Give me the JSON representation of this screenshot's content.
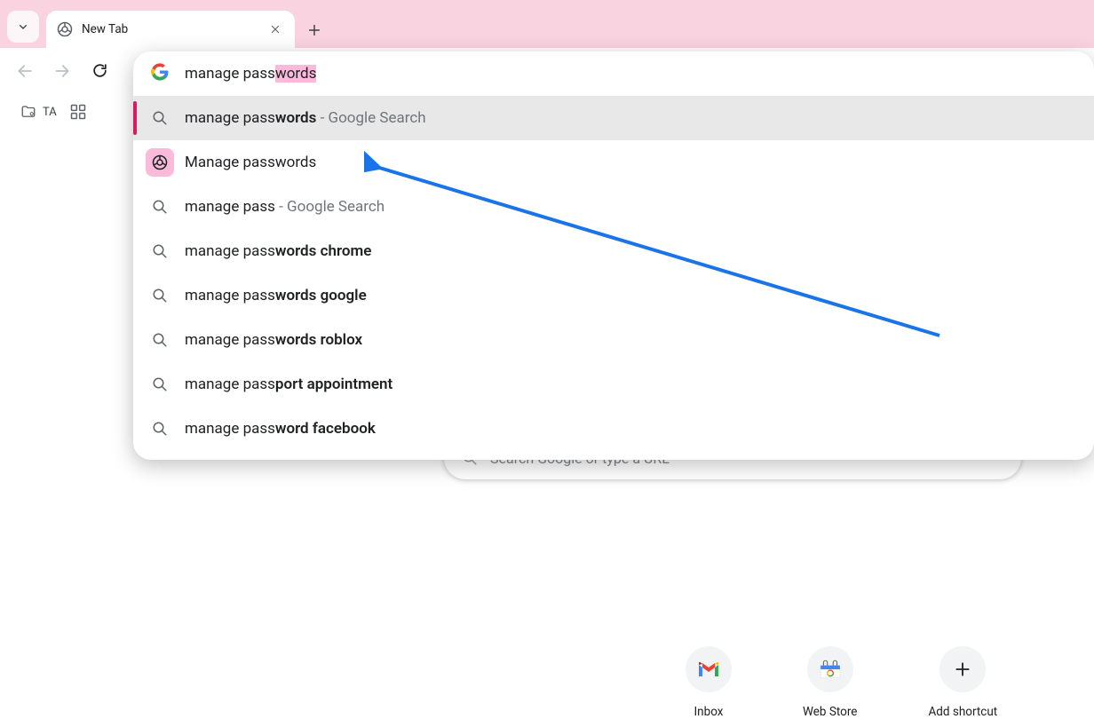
{
  "tab": {
    "title": "New Tab"
  },
  "bookmarks": {
    "ta_label": "TA"
  },
  "omnibox": {
    "query_plain": "manage pass",
    "query_highlight": "words",
    "suggestions": [
      {
        "kind": "search-selected",
        "prefix": "manage pass",
        "bold": "words",
        "suffix": " - Google Search"
      },
      {
        "kind": "chrome-setting",
        "label": "Manage passwords"
      },
      {
        "kind": "search",
        "prefix": "manage pass",
        "bold": "",
        "suffix": " - Google Search"
      },
      {
        "kind": "search",
        "prefix": "manage pass",
        "bold": "words chrome",
        "suffix": ""
      },
      {
        "kind": "search",
        "prefix": "manage pass",
        "bold": "words google",
        "suffix": ""
      },
      {
        "kind": "search",
        "prefix": "manage pass",
        "bold": "words roblox",
        "suffix": ""
      },
      {
        "kind": "search",
        "prefix": "manage pass",
        "bold": "port appointment",
        "suffix": ""
      },
      {
        "kind": "search",
        "prefix": "manage pass",
        "bold": "word facebook",
        "suffix": ""
      }
    ]
  },
  "ntp": {
    "search_placeholder": "Search Google or type a URL",
    "shortcuts": [
      {
        "label": "Inbox"
      },
      {
        "label": "Web Store"
      },
      {
        "label": "Add shortcut"
      }
    ]
  }
}
